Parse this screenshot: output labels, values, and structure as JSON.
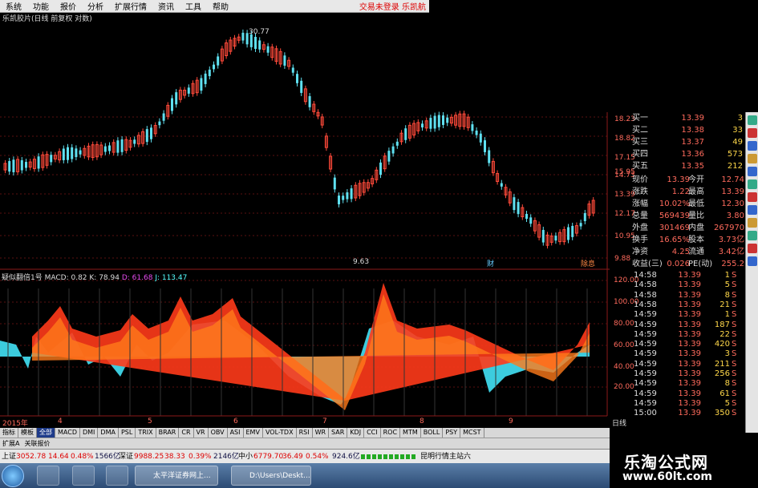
{
  "menu": {
    "items": [
      "系统",
      "功能",
      "报价",
      "分析",
      "扩展行情",
      "资讯",
      "工具",
      "帮助"
    ],
    "right": "交易未登录 乐凯航"
  },
  "chart_title": "乐凯胶片(日线 前复权 对数)",
  "price_chart": {
    "high_label": "30.77",
    "low_label": "9.63",
    "marker_1": "财",
    "marker_2": "除息",
    "y_ticks": [
      "18.23",
      "18.82",
      "17.15",
      "15.95",
      "14.73",
      "13.39",
      "12.17",
      "10.95",
      "9.88"
    ]
  },
  "indicator": {
    "title": "疑似翻倍1号",
    "macd": "MACD: 0.82",
    "k": "K: 78.94",
    "d": "D: 61.68",
    "j": "J: 113.47",
    "y_ticks": [
      "120.00",
      "100.00",
      "80.00",
      "60.00",
      "40.00",
      "20.00"
    ]
  },
  "x_axis": {
    "year": "2015年",
    "months": [
      "4",
      "5",
      "6",
      "7",
      "8",
      "9"
    ],
    "period": "日线"
  },
  "quote": {
    "bids": [
      {
        "label": "买一",
        "price": "13.39",
        "vol": "3"
      },
      {
        "label": "买二",
        "price": "13.38",
        "vol": "33"
      },
      {
        "label": "买三",
        "price": "13.37",
        "vol": "49"
      },
      {
        "label": "买四",
        "price": "13.36",
        "vol": "573"
      },
      {
        "label": "买五",
        "price": "13.35",
        "vol": "212"
      }
    ],
    "stats": [
      {
        "l1": "现价",
        "v1": "13.39",
        "l2": "今开",
        "v2": "12.74"
      },
      {
        "l1": "涨跌",
        "v1": "1.22",
        "l2": "最高",
        "v2": "13.39"
      },
      {
        "l1": "涨幅",
        "v1": "10.02%",
        "l2": "最低",
        "v2": "12.30"
      },
      {
        "l1": "总量",
        "v1": "569439",
        "l2": "量比",
        "v2": "3.80"
      },
      {
        "l1": "外盘",
        "v1": "301469",
        "l2": "内盘",
        "v2": "267970"
      },
      {
        "l1": "换手",
        "v1": "16.65%",
        "l2": "股本",
        "v2": "3.73亿"
      },
      {
        "l1": "净资",
        "v1": "4.25",
        "l2": "流通",
        "v2": "3.42亿"
      },
      {
        "l1": "收益(三)",
        "v1": "0.026",
        "l2": "PE(动)",
        "v2": "255.2"
      }
    ]
  },
  "ticks": [
    {
      "time": "14:58",
      "price": "13.39",
      "vol": "1",
      "side": "S"
    },
    {
      "time": "14:58",
      "price": "13.39",
      "vol": "5",
      "side": "S"
    },
    {
      "time": "14:58",
      "price": "13.39",
      "vol": "8",
      "side": "S"
    },
    {
      "time": "14:58",
      "price": "13.39",
      "vol": "21",
      "side": "S"
    },
    {
      "time": "14:59",
      "price": "13.39",
      "vol": "1",
      "side": "S"
    },
    {
      "time": "14:59",
      "price": "13.39",
      "vol": "187",
      "side": "S"
    },
    {
      "time": "14:59",
      "price": "13.39",
      "vol": "22",
      "side": "S"
    },
    {
      "time": "14:59",
      "price": "13.39",
      "vol": "420",
      "side": "S"
    },
    {
      "time": "14:59",
      "price": "13.39",
      "vol": "3",
      "side": "S"
    },
    {
      "time": "14:59",
      "price": "13.39",
      "vol": "211",
      "side": "S"
    },
    {
      "time": "14:59",
      "price": "13.39",
      "vol": "256",
      "side": "S"
    },
    {
      "time": "14:59",
      "price": "13.39",
      "vol": "8",
      "side": "S"
    },
    {
      "time": "14:59",
      "price": "13.39",
      "vol": "61",
      "side": "S"
    },
    {
      "time": "14:59",
      "price": "13.39",
      "vol": "5",
      "side": "S"
    },
    {
      "time": "15:00",
      "price": "13.39",
      "vol": "350",
      "side": "S"
    }
  ],
  "tabs": [
    "指标",
    "模板",
    "全部",
    "MACD",
    "DMI",
    "DMA",
    "PSL",
    "TRIX",
    "BRAR",
    "CR",
    "VR",
    "OBV",
    "ASI",
    "EMV",
    "VOL-TDX",
    "RSI",
    "WR",
    "SAR",
    "KDJ",
    "CCI",
    "ROC",
    "MTM",
    "BOLL",
    "PSY",
    "MCST"
  ],
  "tabs2": [
    "扩展A",
    "关联报价"
  ],
  "status": {
    "sh_label": "上证",
    "sh_val": "3052.78",
    "sh_chg": "14.64",
    "sh_pct": "0.48%",
    "sh_amt": "1566亿",
    "sz_label": "深证",
    "sz_val": "9988.25",
    "sz_chg": "38.33",
    "sz_pct": "0.39%",
    "sz_amt": "2146亿",
    "zx_label": "中小",
    "zx_val": "6779.70",
    "zx_chg": "36.49",
    "zx_pct": "0.54%",
    "zx_amt": "924.6亿",
    "server": "昆明行情主站六"
  },
  "taskbar": {
    "task1": "太平洋证券网上...",
    "task2": "D:\\Users\\Deskt..."
  },
  "watermark": {
    "title": "乐淘公式网",
    "url": "www.60lt.com"
  }
}
